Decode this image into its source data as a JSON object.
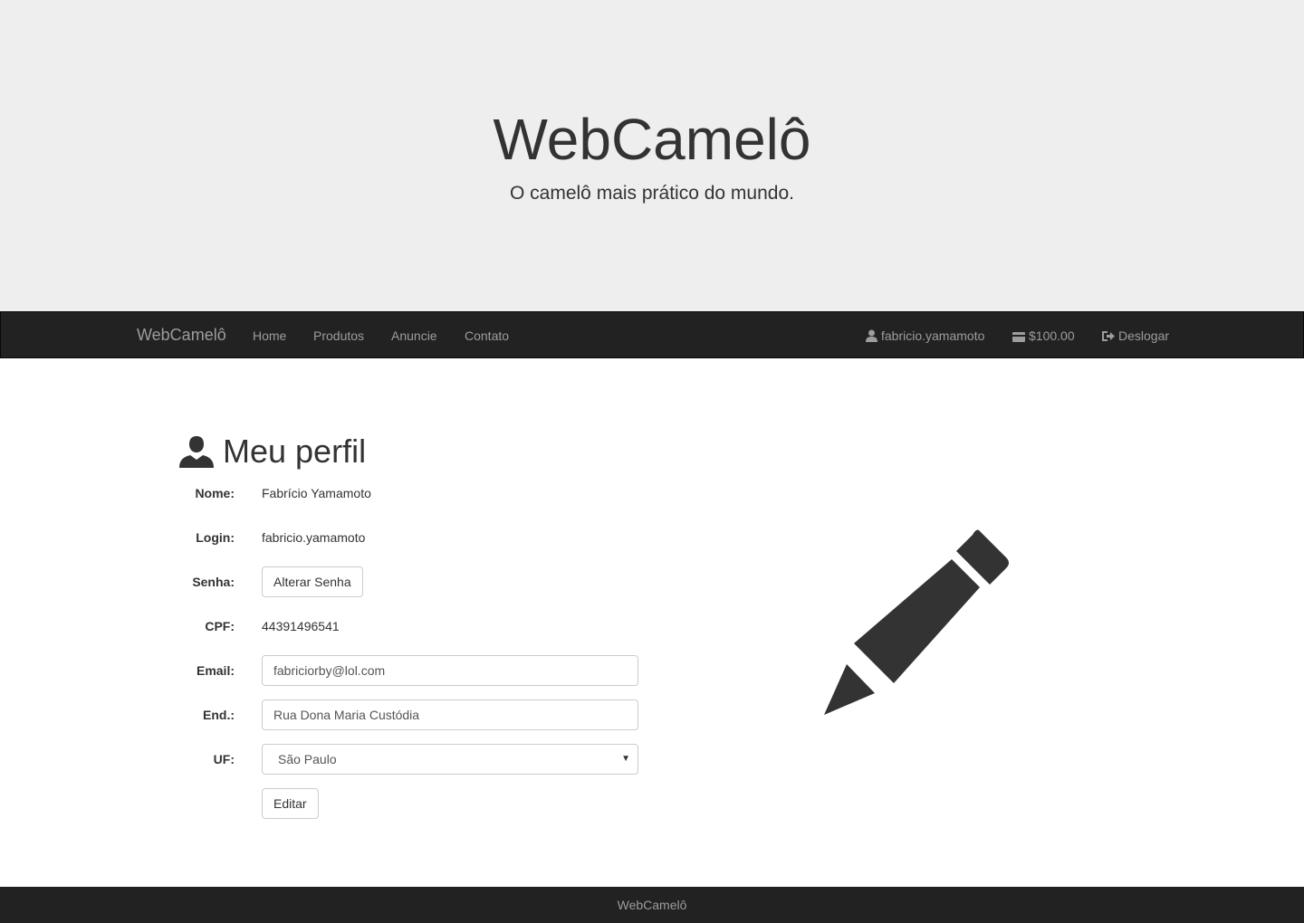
{
  "jumbotron": {
    "title": "WebCamelô",
    "subtitle": "O camelô mais prático do mundo."
  },
  "navbar": {
    "brand": "WebCamelô",
    "links": [
      "Home",
      "Produtos",
      "Anuncie",
      "Contato"
    ],
    "user": "fabricio.yamamoto",
    "balance": "$100.00",
    "logout": "Deslogar"
  },
  "profile": {
    "title": "Meu perfil",
    "labels": {
      "nome": "Nome:",
      "login": "Login:",
      "senha": "Senha:",
      "cpf": "CPF:",
      "email": "Email:",
      "end": "End.:",
      "uf": "UF:"
    },
    "nome": "Fabrício Yamamoto",
    "login": "fabricio.yamamoto",
    "change_password": "Alterar Senha",
    "cpf": "44391496541",
    "email": "fabriciorby@lol.com",
    "endereco": "Rua Dona Maria Custódia",
    "uf": "São Paulo",
    "edit_button": "Editar"
  },
  "footer": {
    "text": "WebCamelô"
  },
  "icons": {
    "title_icon": "user-icon",
    "side_icon": "pencil-icon"
  },
  "colors": {
    "jumbotron_bg": "#eeeeee",
    "navbar_bg": "#222222",
    "navbar_text": "#9d9d9d",
    "text": "#333333"
  }
}
